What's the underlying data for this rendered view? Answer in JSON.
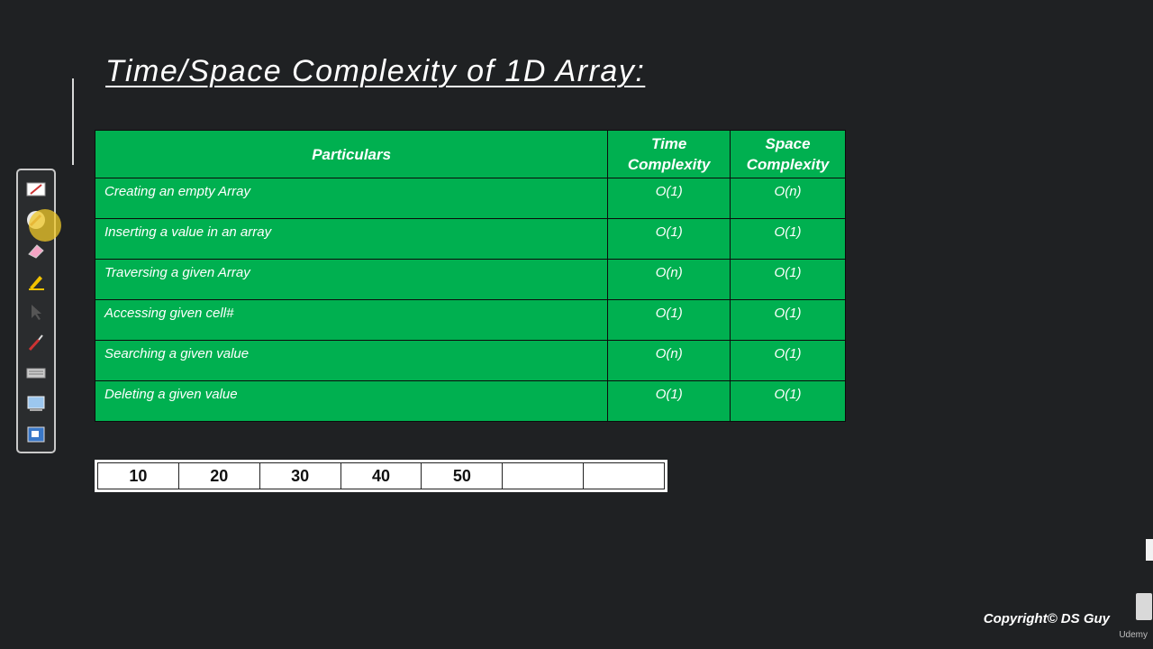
{
  "slide": {
    "title": "Time/Space Complexity of 1D Array:",
    "copyright": "Copyright© DS Guy",
    "watermark": "Udemy"
  },
  "table": {
    "headers": [
      "Particulars",
      "Time Complexity",
      "Space Complexity"
    ],
    "rows": [
      {
        "particular": "Creating an empty Array",
        "time": "O(1)",
        "space": "O(n)"
      },
      {
        "particular": "Inserting a value in an array",
        "time": "O(1)",
        "space": "O(1)"
      },
      {
        "particular": "Traversing a given Array",
        "time": "O(n)",
        "space": "O(1)"
      },
      {
        "particular": "Accessing given cell#",
        "time": "O(1)",
        "space": "O(1)"
      },
      {
        "particular": "Searching a given value",
        "time": "O(n)",
        "space": "O(1)"
      },
      {
        "particular": "Deleting a given value",
        "time": "O(1)",
        "space": "O(1)"
      }
    ]
  },
  "array_cells": [
    "10",
    "20",
    "30",
    "40",
    "50",
    "",
    ""
  ],
  "toolbar": {
    "tools": [
      "screen-capture-icon",
      "pen-icon",
      "eraser-icon",
      "highlighter-icon",
      "pointer-icon",
      "brush-icon",
      "keyboard-icon",
      "whiteboard-icon",
      "screenshot-icon"
    ]
  },
  "colors": {
    "background": "#1f2123",
    "table_fill": "#00b050",
    "highlight": "#f0c828"
  }
}
